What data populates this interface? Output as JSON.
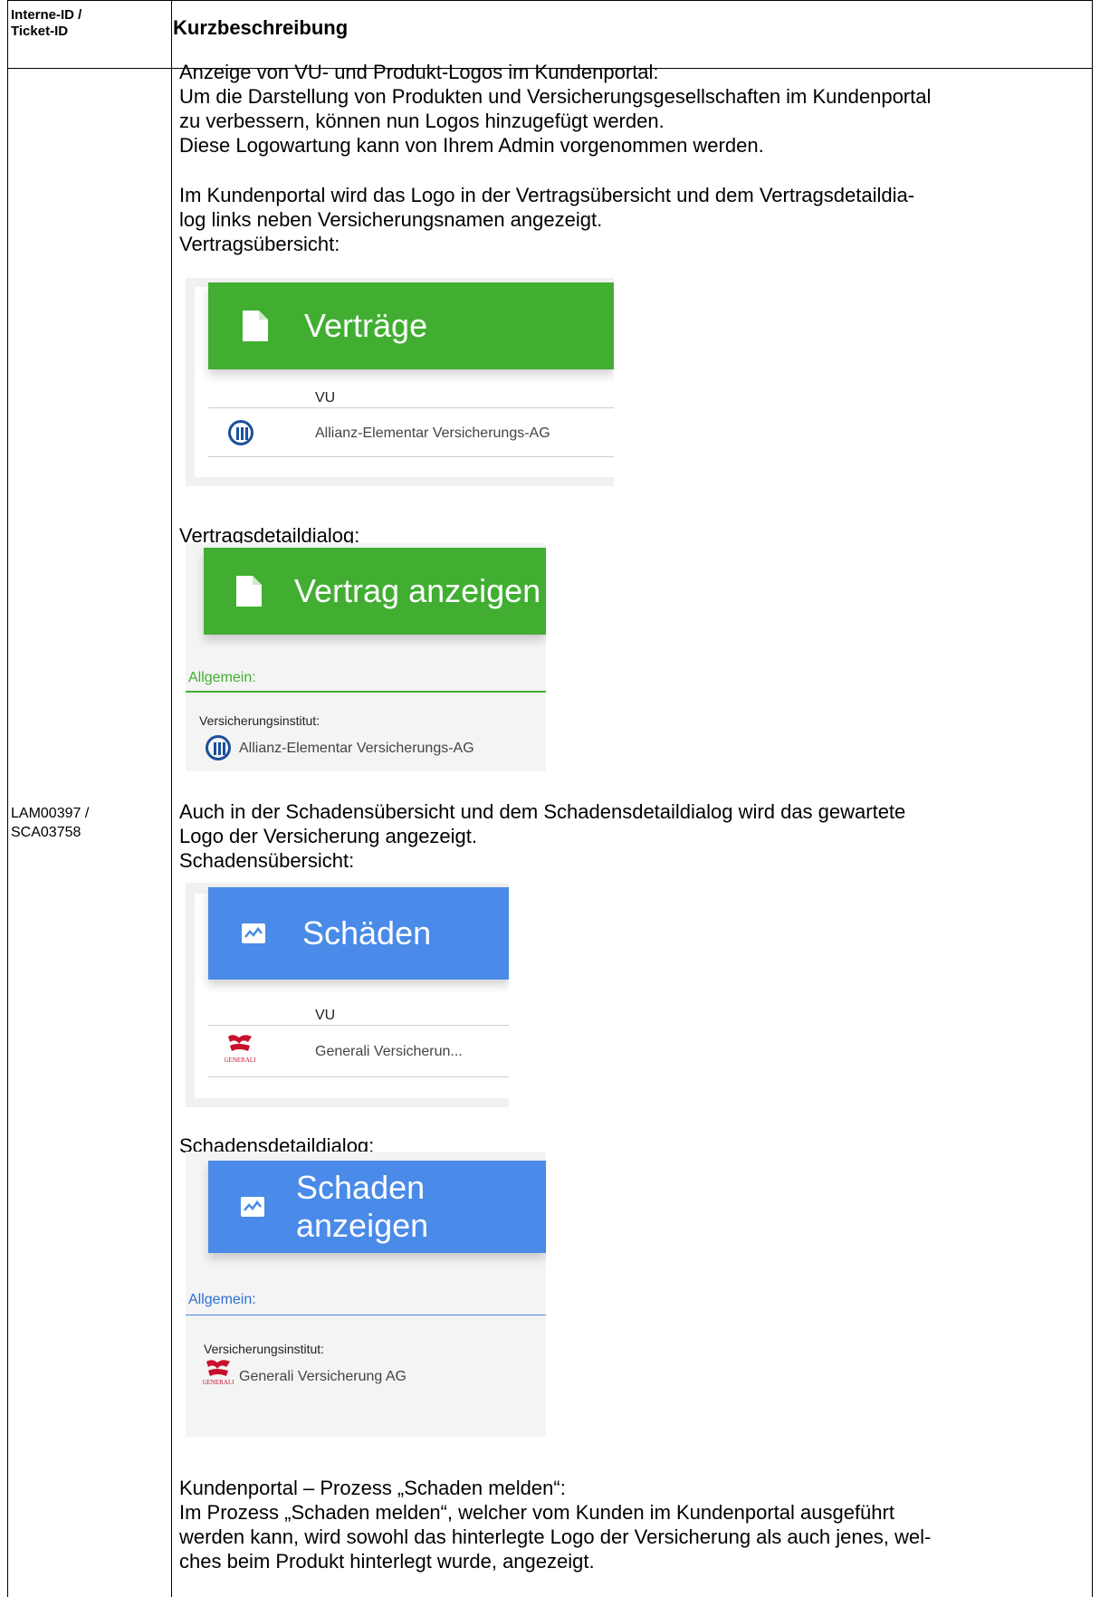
{
  "header": {
    "id_label": "Interne-ID /\nTicket-ID",
    "desc_label": "Kurzbeschreibung"
  },
  "row": {
    "ticket_id": "LAM00397 /\nSCA03758",
    "p1": "Anzeige von VU- und Produkt-Logos im Kundenportal:\nUm die Darstellung von Produkten und Versicherungsgesellschaften im Kundenportal\nzu verbessern, können nun Logos hinzugefügt werden.\nDiese Logowartung kann von Ihrem Admin vorgenommen werden.",
    "p2": "Im Kundenportal wird das Logo in der Vertragsübersicht und dem Vertragsdetaildia-\nlog links neben Versicherungsnamen angezeigt.\nVertragsübersicht:",
    "p3": "Vertragsdetaildialog:",
    "p4": "Auch in der Schadensübersicht und dem Schadensdetaildialog wird das gewartete\nLogo der Versicherung angezeigt.\nSchadensübersicht:",
    "p5": "Schadensdetaildialog:",
    "p6": "Kundenportal – Prozess „Schaden melden“:\nIm Prozess „Schaden melden“, welcher vom Kunden im Kundenportal ausgeführt\nwerden kann, wird sowohl das hinterlegte Logo der Versicherung als auch jenes, wel-\nches beim Produkt hinterlegt wurde, angezeigt."
  },
  "shots": {
    "vertraege": {
      "title": "Verträge",
      "col": "VU",
      "insurer": "Allianz-Elementar Versicherungs-AG"
    },
    "vertrag_detail": {
      "title": "Vertrag anzeigen",
      "section": "Allgemein:",
      "field": "Versicherungsinstitut:",
      "insurer": "Allianz-Elementar Versicherungs-AG"
    },
    "schaeden": {
      "title": "Schäden",
      "col": "VU",
      "insurer": "Generali Versicherun..."
    },
    "schaden_detail": {
      "title": "Schaden anzeigen",
      "section": "Allgemein:",
      "field": "Versicherungsinstitut:",
      "insurer": "Generali Versicherung AG"
    }
  },
  "colors": {
    "green": "#41ae32",
    "blue": "#4a8ae8",
    "allianz_blue": "#1b4f9a",
    "generali_red": "#c8102e"
  },
  "logos": {
    "generali_word": "GENERALI"
  }
}
